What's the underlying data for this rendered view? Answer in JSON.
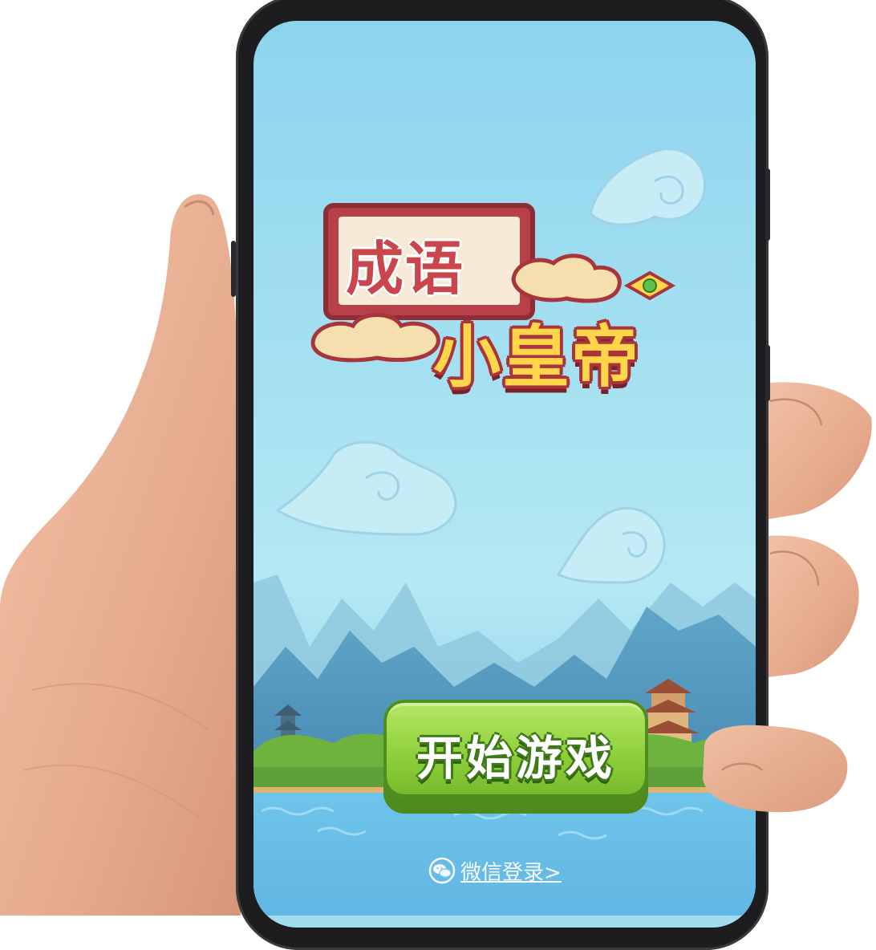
{
  "game": {
    "title_line1": "成语",
    "title_line2": "小皇帝"
  },
  "buttons": {
    "start_label": "开始游戏",
    "wechat_login_label": "微信登录>"
  },
  "icons": {
    "login": "wechat-icon"
  },
  "colors": {
    "sky": "#a6e1f1",
    "button_green": "#8fd13b",
    "title_red": "#c9464c",
    "title_gold": "#ffd54a"
  }
}
